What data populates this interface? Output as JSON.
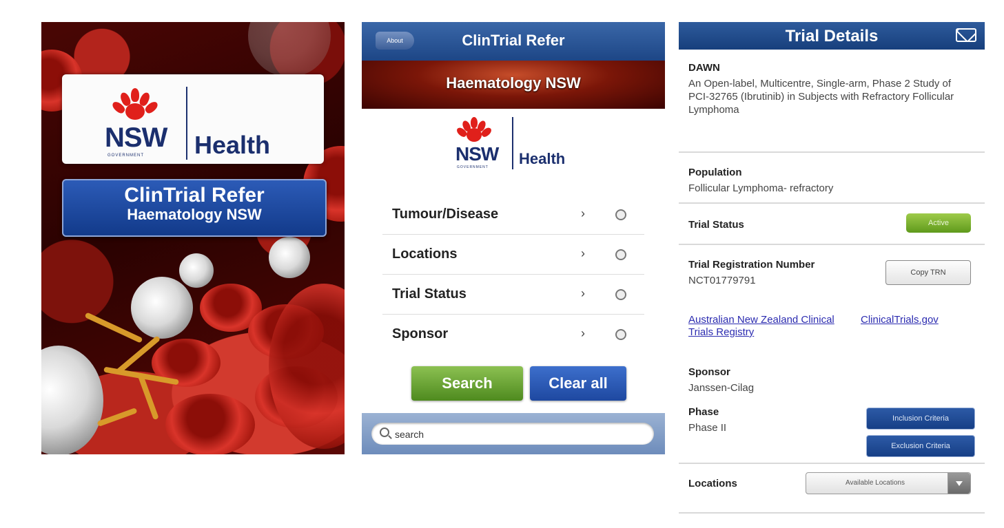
{
  "splash": {
    "logo": {
      "nsw": "NSW",
      "government": "GOVERNMENT",
      "health": "Health"
    },
    "banner": {
      "title": "ClinTrial Refer",
      "subtitle": "Haematology NSW"
    }
  },
  "search_screen": {
    "navbar": {
      "back_label": "About",
      "title": "ClinTrial Refer"
    },
    "banner": "Haematology NSW",
    "logo": {
      "nsw": "NSW",
      "government": "GOVERNMENT",
      "health": "Health"
    },
    "filters": [
      {
        "label": "Tumour/Disease"
      },
      {
        "label": "Locations"
      },
      {
        "label": "Trial Status"
      },
      {
        "label": "Sponsor"
      }
    ],
    "buttons": {
      "search": "Search",
      "clear": "Clear all"
    },
    "search": {
      "placeholder": "search",
      "value": "search"
    }
  },
  "details": {
    "navbar": {
      "title": "Trial Details"
    },
    "trial": {
      "acronym": "DAWN",
      "description": "An Open-label, Multicentre, Single-arm, Phase 2 Study of PCI-32765 (Ibrutinib) in Subjects with Refractory Follicular Lymphoma"
    },
    "population": {
      "heading": "Population",
      "value": "Follicular Lymphoma- refractory"
    },
    "trial_status": {
      "heading": "Trial Status",
      "badge": "Active"
    },
    "registration": {
      "heading": "Trial Registration Number",
      "value": "NCT01779791",
      "copy_button": "Copy TRN"
    },
    "links": {
      "anzctr": "Australian New Zealand Clinical Trials Registry",
      "clinicaltrials": "ClinicalTrials.gov"
    },
    "sponsor": {
      "heading": "Sponsor",
      "value": "Janssen-Cilag"
    },
    "phase": {
      "heading": "Phase",
      "value": "Phase II"
    },
    "criteria": {
      "inclusion": "Inclusion Criteria",
      "exclusion": "Exclusion Criteria"
    },
    "locations": {
      "heading": "Locations",
      "selected": "Available Locations"
    }
  },
  "colors": {
    "nav_blue": "#1d4686",
    "banner_blue": "#123a8a",
    "search_green": "#6aa532",
    "clear_blue": "#2a58b4",
    "nsw_red": "#e0201b",
    "nsw_navy": "#1b2f6e",
    "link_color": "#2b2bb0"
  },
  "icons": [
    "back-arrow-icon",
    "chevron-right-icon",
    "radio-icon",
    "search-icon",
    "mail-icon",
    "dropdown-arrow-icon"
  ]
}
